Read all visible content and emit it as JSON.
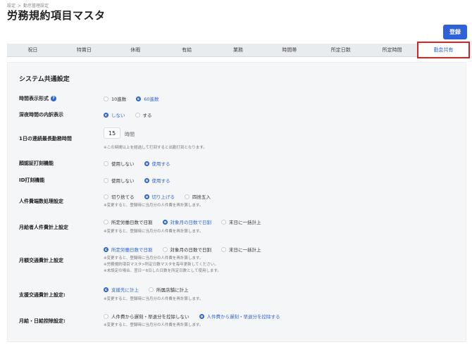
{
  "breadcrumb": {
    "parent": "設定",
    "separator": ">",
    "current": "勤怠管理設定"
  },
  "page_title": "労務規約項目マスタ",
  "register_label": "登録",
  "tabs": [
    {
      "label": "祝日"
    },
    {
      "label": "特賞日"
    },
    {
      "label": "休暇"
    },
    {
      "label": "有給"
    },
    {
      "label": "業務"
    },
    {
      "label": "時間帯"
    },
    {
      "label": "所定日数"
    },
    {
      "label": "所定時間"
    },
    {
      "label": "勤怠共有",
      "active": true
    }
  ],
  "section_title": "システム共通設定",
  "settings": {
    "time_format": {
      "label": "時間表示形式",
      "options": [
        "10進数",
        "60進数"
      ],
      "selected": 1
    },
    "midnight": {
      "label": "深夜時間の内訳表示",
      "options": [
        "しない",
        "する"
      ],
      "selected": 0
    },
    "max_hours": {
      "label": "1日の連続最長勤務時間",
      "value": "15",
      "unit": "時間",
      "note": "※この時間以上を経過して打刻すると出勤打刻となります。"
    },
    "face_auth": {
      "label": "顔認証打刻機能",
      "options": [
        "使用しない",
        "使用する"
      ],
      "selected": 1
    },
    "id_punch": {
      "label": "ID打刻機能",
      "options": [
        "使用しない",
        "使用する"
      ],
      "selected": 1
    },
    "rounding": {
      "label": "人件費端数処理設定",
      "options": [
        "切り捨てる",
        "切り上げる",
        "四捨五入"
      ],
      "selected": 1,
      "note": "※変更すると、登録時に当月分の人件費を再計算します。"
    },
    "monthly_salary": {
      "label": "月給者人件費計上設定",
      "options": [
        "所定労働日数で日割",
        "対象月の日数で日割",
        "末日に一括計上"
      ],
      "selected": 1,
      "note": "※変更すると、登録時に当月分の人件費を再計算します。"
    },
    "transport_monthly": {
      "label": "月額交通費計上設定",
      "options": [
        "所定労働日数で日割",
        "対象月の日数で日割",
        "末日に一括計上"
      ],
      "selected": 0,
      "notes": [
        "※変更すると、登録時に当月分の人件費を再計算します。",
        "※労務規約項目マスタ>所定日数マスタを毎年更新してください。",
        "※未設定の場合、翌日ー8日した日数を所定日数として使用します。"
      ]
    },
    "support_transport": {
      "label": "支援交通費計上設定:",
      "options": [
        "支援先に計上",
        "所属店舗に計上"
      ],
      "selected": 0,
      "note": "※変更すると、登録時に当月分の人件費を再計算します。"
    },
    "deduction": {
      "label": "月給・日給控除設定:",
      "options": [
        "人件費から遅刻・早退分を控除しない",
        "人件費から遅刻・早退分を控除する"
      ],
      "selected": 1,
      "note": "※変更すると、登録時に当月分の人件費を再計算します。"
    }
  },
  "colors": {
    "accent": "#2f62d8",
    "highlight_border": "#e02020"
  }
}
